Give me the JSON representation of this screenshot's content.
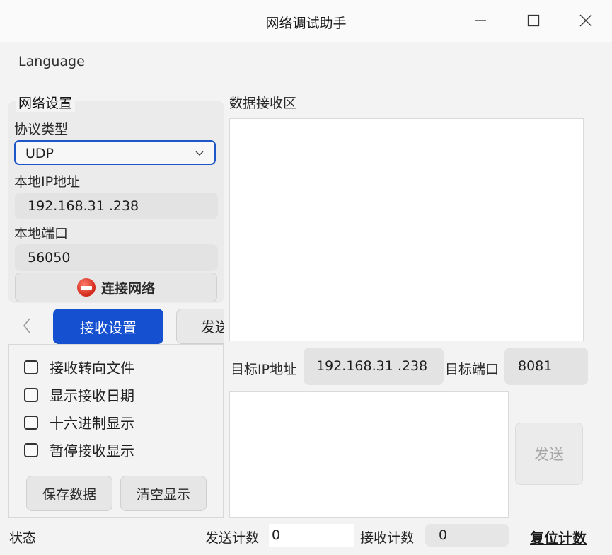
{
  "window": {
    "title": "网络调试助手",
    "minimize_icon": "minimize-icon",
    "maximize_icon": "maximize-icon",
    "close_icon": "close-icon"
  },
  "menu": {
    "language": "Language"
  },
  "network": {
    "group_title": "网络设置",
    "protocol_label": "协议类型",
    "protocol_value": "UDP",
    "local_ip_label": "本地IP地址",
    "local_ip_value": "192.168.31 .238",
    "local_port_label": "本地端口",
    "local_port_value": "56050",
    "connect_label": "连接网络",
    "connect_icon": "stop-icon"
  },
  "tabs": {
    "active": "接收设置",
    "other": "发送"
  },
  "receive_settings": {
    "options": [
      {
        "label": "接收转向文件",
        "checked": false
      },
      {
        "label": "显示接收日期",
        "checked": false
      },
      {
        "label": "十六进制显示",
        "checked": false
      },
      {
        "label": "暂停接收显示",
        "checked": false
      }
    ],
    "save_label": "保存数据",
    "clear_label": "清空显示"
  },
  "receive_area": {
    "label": "数据接收区"
  },
  "target": {
    "ip_label": "目标IP地址",
    "ip_value": "192.168.31 .238",
    "port_label": "目标端口",
    "port_value": "8081"
  },
  "send": {
    "button_label": "发送"
  },
  "status_bar": {
    "status_label": "状态",
    "send_count_label": "发送计数",
    "send_count_value": "0",
    "recv_count_label": "接收计数",
    "recv_count_value": "0",
    "reset_label": "复位计数"
  },
  "colors": {
    "accent": "#1550d0",
    "focus_border": "#1e55c8",
    "disabled_text": "#a8a8a8"
  }
}
